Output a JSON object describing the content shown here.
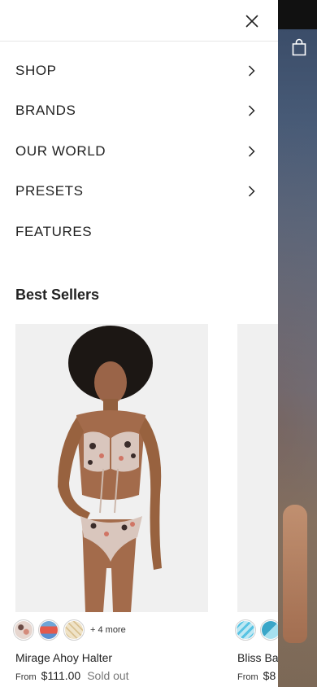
{
  "header": {
    "close_icon": "close-icon"
  },
  "cart": {
    "icon": "shopping-bag-icon"
  },
  "menu": {
    "items": [
      {
        "label": "SHOP",
        "has_submenu": true
      },
      {
        "label": "BRANDS",
        "has_submenu": true
      },
      {
        "label": "OUR WORLD",
        "has_submenu": true
      },
      {
        "label": "PRESETS",
        "has_submenu": true
      },
      {
        "label": "FEATURES",
        "has_submenu": false
      }
    ]
  },
  "best_sellers": {
    "title": "Best Sellers",
    "products": [
      {
        "name": "Mirage Ahoy Halter",
        "from_label": "From",
        "price": "$111.00",
        "status": "Sold out",
        "swatches": [
          "#b08a82",
          "#e25a5a",
          "#e6d6b8"
        ],
        "more_colors": "+ 4 more"
      },
      {
        "name": "Bliss Ba",
        "from_label": "From",
        "price": "$8",
        "swatches": [
          "#66c8e6",
          "#3aa6c8"
        ]
      }
    ]
  },
  "colors": {
    "drawer_bg": "#ffffff",
    "text": "#222222",
    "muted": "#777777",
    "image_bg": "#f0f0f0"
  }
}
